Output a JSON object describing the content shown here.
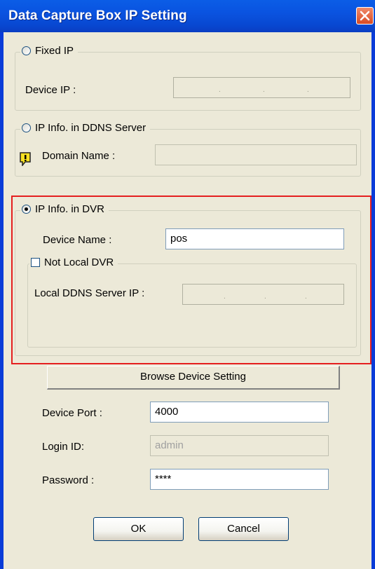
{
  "window": {
    "title": "Data Capture Box IP Setting"
  },
  "fixed_ip": {
    "label": "Fixed IP",
    "device_ip_label": "Device IP :",
    "device_ip_value": ". . ."
  },
  "ddns": {
    "label": "IP Info. in DDNS Server",
    "domain_label": "Domain Name :",
    "domain_value": ""
  },
  "dvr": {
    "label": "IP Info. in DVR",
    "device_name_label": "Device Name :",
    "device_name_value": "pos",
    "not_local": {
      "label": "Not Local DVR",
      "local_ddns_label": "Local DDNS Server IP :"
    }
  },
  "browse_button": "Browse Device Setting",
  "device_port": {
    "label": "Device Port :",
    "value": "4000"
  },
  "login_id": {
    "label": "Login ID:",
    "value": "admin"
  },
  "password": {
    "label": "Password :",
    "value": "****"
  },
  "buttons": {
    "ok": "OK",
    "cancel": "Cancel"
  },
  "colors": {
    "titlebar": "#0a53e0",
    "dialog_bg": "#ece9d8",
    "highlight": "#e51f1f",
    "selected_radio": "#000000"
  },
  "icons": {
    "close": "close-icon",
    "warning": "warning-icon"
  }
}
